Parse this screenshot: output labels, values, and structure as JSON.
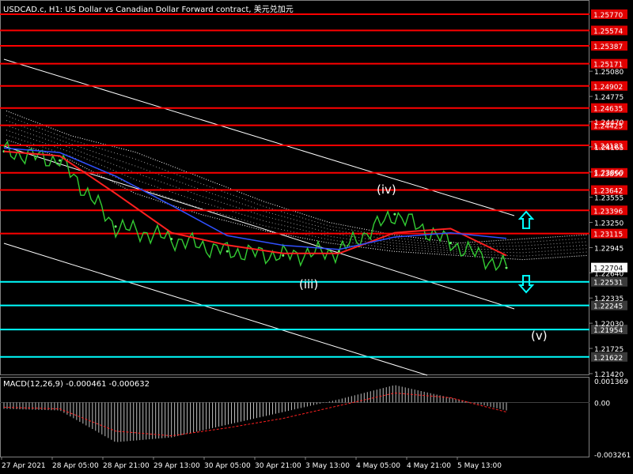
{
  "header": {
    "title": "USDCAD.c, H1:  US Dollar vs Canadian Dollar Forward contract, 美元兑加元"
  },
  "macd_panel": {
    "label": "MACD(12,26,9) -0.000461 -0.000632",
    "axis_ticks": [
      "0.001369",
      "0.00",
      "-0.003261"
    ]
  },
  "price_axis": {
    "ticks": [
      "1.25080",
      "1.24775",
      "1.24470",
      "1.24165",
      "1.23860",
      "1.23555",
      "1.23250",
      "1.22945",
      "1.22640",
      "1.22335",
      "1.22030",
      "1.21725",
      "1.21420"
    ]
  },
  "levels": {
    "resistance_color": "#ff0000",
    "support_color": "#00ffff",
    "resistance": [
      "1.25770",
      "1.25574",
      "1.25387",
      "1.25171",
      "1.24902",
      "1.24635",
      "1.24425",
      "1.24183",
      "1.23850",
      "1.23642",
      "1.23396",
      "1.23115"
    ],
    "current_price": "1.22704",
    "support": [
      "1.22531",
      "1.22245",
      "1.21954",
      "1.21622"
    ]
  },
  "time_axis": {
    "labels": [
      "27 Apr 2021",
      "28 Apr 05:00",
      "28 Apr 21:00",
      "29 Apr 13:00",
      "30 Apr 05:00",
      "30 Apr 21:00",
      "3 May 13:00",
      "4 May 05:00",
      "4 May 21:00",
      "5 May 13:00"
    ]
  },
  "annotations": {
    "wave_iii": "(iii)",
    "wave_iv": "(iv)",
    "wave_v": "(v)"
  },
  "arrows": {
    "up_icon": "arrow-up-icon",
    "down_icon": "arrow-down-icon",
    "color": "#00ffff"
  },
  "chart_data": {
    "type": "line",
    "title": "USDCAD.c, H1:  US Dollar vs Canadian Dollar Forward contract, 美元兑加元",
    "ylim": [
      1.2112,
      1.2605
    ],
    "x": [
      "27 Apr 2021",
      "28 Apr 05:00",
      "28 Apr 21:00",
      "29 Apr 13:00",
      "30 Apr 05:00",
      "30 Apr 21:00",
      "3 May 13:00",
      "4 May 05:00",
      "4 May 21:00",
      "5 May 13:00"
    ],
    "series": [
      {
        "values": [
          1.2411,
          1.24,
          1.232,
          1.2305,
          1.229,
          1.2285,
          1.229,
          1.2335,
          1.23,
          1.227
        ]
      }
    ],
    "macd": {
      "ylim": [
        -0.003261,
        0.001369
      ],
      "histogram": [
        -0.0004,
        -0.0005,
        -0.0025,
        -0.0022,
        -0.0014,
        -0.0006,
        0.0002,
        0.0011,
        0.0003,
        -0.0005
      ],
      "signal": [
        -0.0003,
        -0.0004,
        -0.0018,
        -0.0021,
        -0.0016,
        -0.001,
        -0.0002,
        0.0006,
        0.0003,
        -0.0006
      ]
    }
  }
}
